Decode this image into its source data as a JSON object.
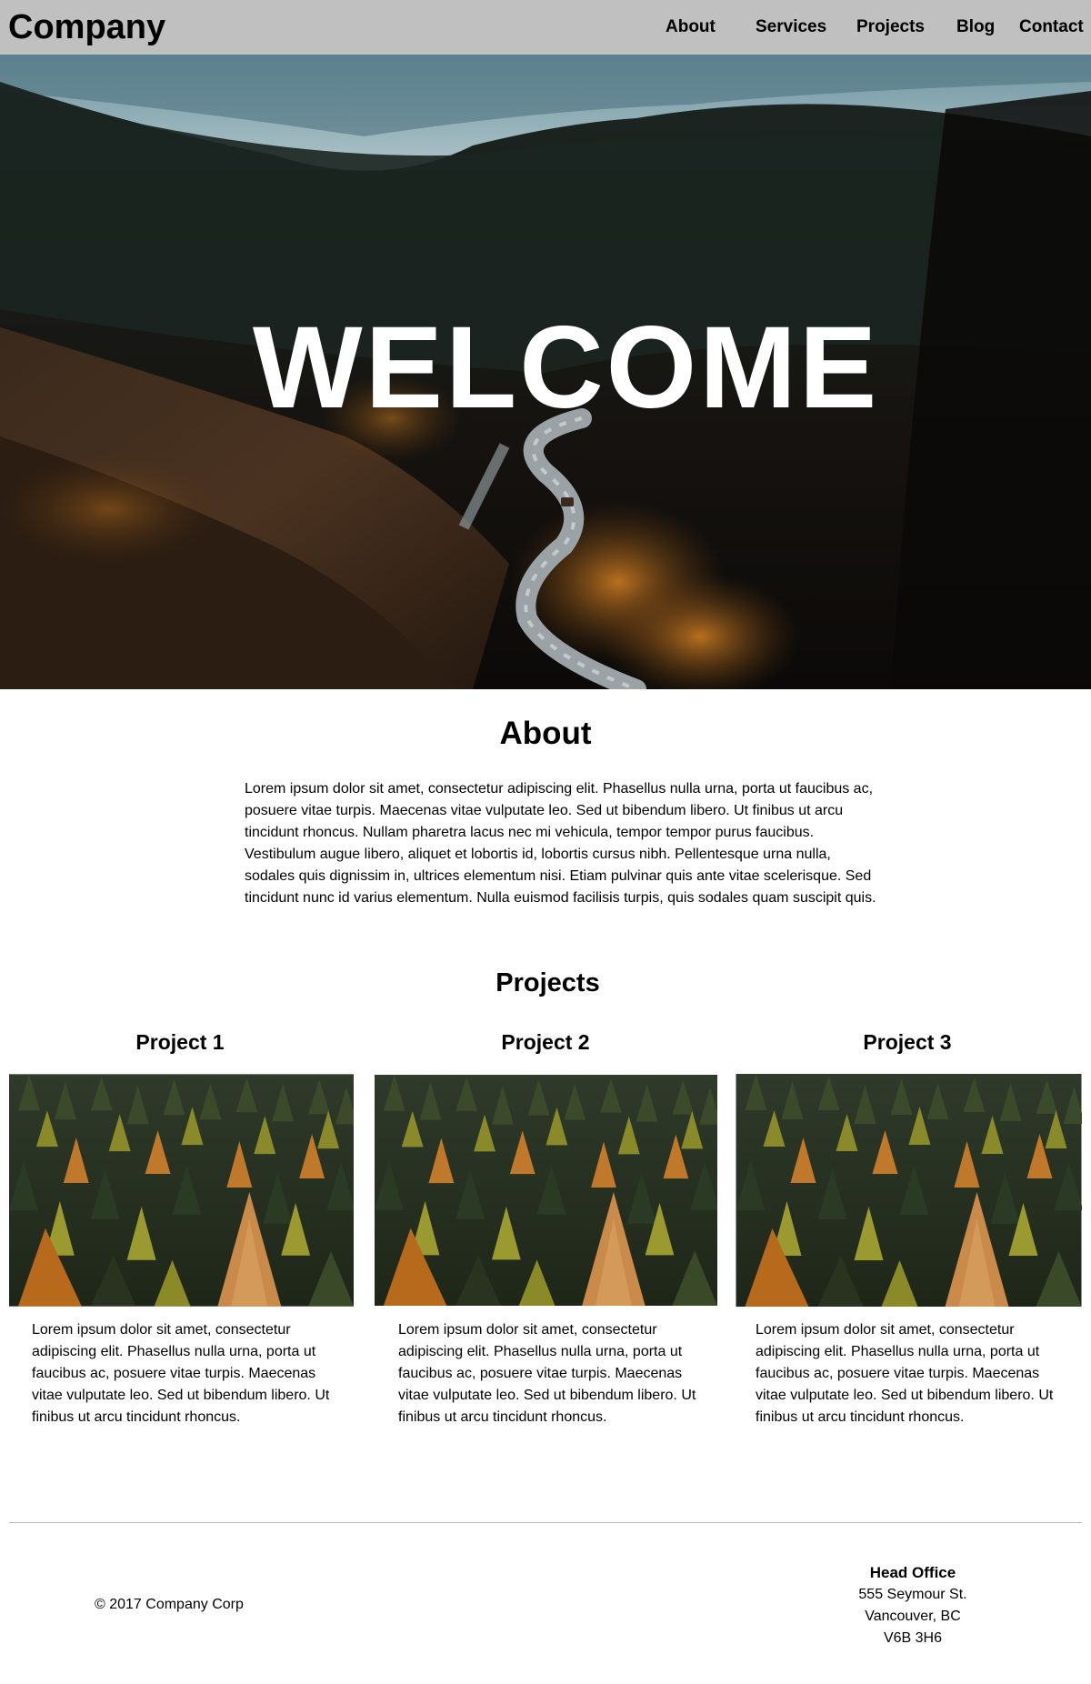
{
  "header": {
    "brand": "Company",
    "nav": [
      "About",
      "Services",
      "Projects",
      "Blog",
      "Contact"
    ]
  },
  "hero": {
    "title": "WELCOME"
  },
  "about": {
    "title": "About",
    "lines": [
      "Lorem ipsum dolor sit amet, consectetur adipiscing elit. Phasellus nulla urna, porta ut faucibus ac,",
      "posuere vitae turpis. Maecenas vitae vulputate leo. Sed ut bibendum libero. Ut finibus ut arcu",
      "tincidunt rhoncus. Nullam pharetra lacus nec mi vehicula, tempor tempor purus faucibus.",
      "Vestibulum augue libero, aliquet et lobortis id, lobortis cursus nibh. Pellentesque urna nulla,",
      "sodales quis dignissim in, ultrices elementum nisi. Etiam pulvinar quis ante vitae scelerisque. Sed",
      "tincidunt nunc id varius elementum. Nulla euismod facilisis turpis, quis sodales quam suscipit quis."
    ]
  },
  "projects": {
    "title": "Projects",
    "items": [
      {
        "title": "Project 1",
        "lines": [
          "Lorem ipsum dolor sit amet, consectetur",
          "adipiscing elit. Phasellus nulla urna, porta ut",
          "faucibus ac, posuere vitae turpis. Maecenas",
          "vitae vulputate leo. Sed ut bibendum libero. Ut",
          "finibus ut arcu tincidunt rhoncus."
        ]
      },
      {
        "title": "Project 2",
        "lines": [
          "Lorem ipsum dolor sit amet, consectetur",
          "adipiscing elit. Phasellus nulla urna, porta ut",
          "faucibus ac, posuere vitae turpis. Maecenas",
          "vitae vulputate leo. Sed ut bibendum libero. Ut",
          "finibus ut arcu tincidunt rhoncus."
        ]
      },
      {
        "title": "Project 3",
        "lines": [
          "Lorem ipsum dolor sit amet, consectetur",
          "adipiscing elit. Phasellus nulla urna, porta ut",
          "faucibus ac, posuere vitae turpis. Maecenas",
          "vitae vulputate leo. Sed ut bibendum libero. Ut",
          "finibus ut arcu tincidunt rhoncus."
        ]
      }
    ]
  },
  "footer": {
    "copyright": "© 2017 Company Corp",
    "office": {
      "title": "Head Office",
      "lines": [
        "555 Seymour St.",
        "Vancouver, BC",
        "V6B 3H6"
      ]
    }
  },
  "colors": {
    "header_bg": "#c0c0c0",
    "hero_text": "#ffffff",
    "rule": "#bdbdbd"
  }
}
